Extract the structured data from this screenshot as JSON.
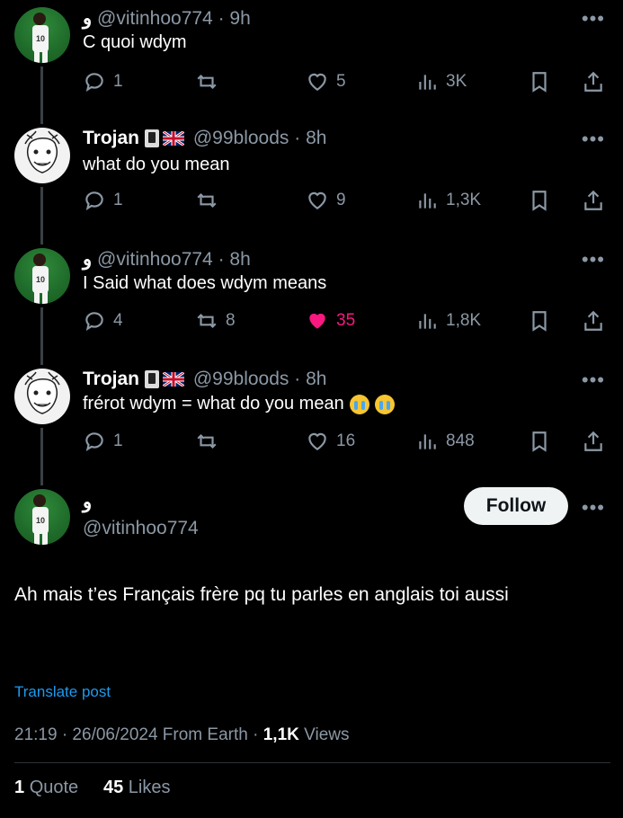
{
  "thread": [
    {
      "avatar": "player-avatar",
      "name": "و",
      "handle": "@vitinhoo774",
      "time": "9h",
      "text": "C quoi wdym",
      "replies": "1",
      "reposts": "",
      "likes": "5",
      "views": "3K",
      "liked": false
    },
    {
      "avatar": "joker-avatar",
      "name": "Trojan",
      "name_badges": [
        "playing-card-icon",
        "uk-flag-icon"
      ],
      "handle": "@99bloods",
      "time": "8h",
      "text": "what do you mean",
      "replies": "1",
      "reposts": "",
      "likes": "9",
      "views": "1,3K",
      "liked": false
    },
    {
      "avatar": "player-avatar",
      "name": "و",
      "handle": "@vitinhoo774",
      "time": "8h",
      "text": "I Said what does wdym means",
      "replies": "4",
      "reposts": "8",
      "likes": "35",
      "views": "1,8K",
      "liked": true
    },
    {
      "avatar": "joker-avatar",
      "name": "Trojan",
      "name_badges": [
        "playing-card-icon",
        "uk-flag-icon"
      ],
      "handle": "@99bloods",
      "time": "8h",
      "text": "frérot wdym = what do you mean",
      "text_emoji": [
        "loudly-crying-face-icon",
        "loudly-crying-face-icon"
      ],
      "replies": "1",
      "reposts": "",
      "likes": "16",
      "views": "848",
      "liked": false
    }
  ],
  "main": {
    "name": "و",
    "handle": "@vitinhoo774",
    "follow_label": "Follow",
    "text": "Ah mais t’es Français frère pq tu parles en anglais toi aussi",
    "translate_label": "Translate post",
    "timestamp": "21:19 · 26/06/2024 From Earth · ",
    "views_count": "1,1K",
    "views_label": " Views",
    "quotes_count": "1",
    "quotes_label": "Quote",
    "likes_count": "45",
    "likes_label": "Likes"
  },
  "colors": {
    "background": "#000000",
    "muted": "#8b98a5",
    "like_pink": "#f91880",
    "link_blue": "#1d9bf0"
  }
}
